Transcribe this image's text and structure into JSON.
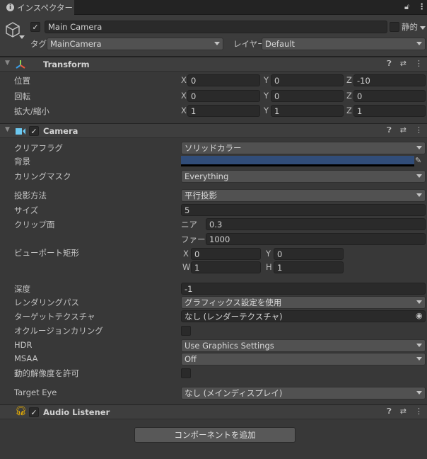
{
  "tab": {
    "title": "インスペクター",
    "icon": "info-icon"
  },
  "tab_icons": [
    "lock-icon",
    "kebab-menu-icon"
  ],
  "object": {
    "active": true,
    "name": "Main Camera",
    "static_label": "静的",
    "static": false,
    "tag_label": "タグ",
    "tag": "MainCamera",
    "layer_label": "レイヤー",
    "layer": "Default",
    "icon": "gameobject-cube-icon"
  },
  "transform": {
    "title": "Transform",
    "icon": "transform-axes-icon",
    "rows": [
      {
        "label": "位置",
        "x": "0",
        "y": "0",
        "z": "-10"
      },
      {
        "label": "回転",
        "x": "0",
        "y": "0",
        "z": "0"
      },
      {
        "label": "拡大/縮小",
        "x": "1",
        "y": "1",
        "z": "1"
      }
    ]
  },
  "axes": {
    "x": "X",
    "y": "Y",
    "z": "Z",
    "w": "W",
    "h": "H"
  },
  "camera": {
    "title": "Camera",
    "enabled": true,
    "icon": "camera-icon",
    "background_color": "#314d79",
    "clear_flags": {
      "label": "クリアフラグ",
      "value": "ソリッドカラー"
    },
    "background": {
      "label": "背景"
    },
    "culling_mask": {
      "label": "カリングマスク",
      "value": "Everything"
    },
    "projection": {
      "label": "投影方法",
      "value": "平行投影"
    },
    "size": {
      "label": "サイズ",
      "value": "5"
    },
    "clipping": {
      "label": "クリップ面",
      "near_label": "ニア",
      "near": "0.3",
      "far_label": "ファー",
      "far": "1000"
    },
    "viewport": {
      "label": "ビューポート矩形",
      "x": "0",
      "y": "0",
      "w": "1",
      "h": "1"
    },
    "depth": {
      "label": "深度",
      "value": "-1"
    },
    "rendering_path": {
      "label": "レンダリングパス",
      "value": "グラフィックス設定を使用"
    },
    "target_texture": {
      "label": "ターゲットテクスチャ",
      "value": "なし (レンダーテクスチャ)"
    },
    "occlusion": {
      "label": "オクルージョンカリング",
      "checked": false
    },
    "hdr": {
      "label": "HDR",
      "value": "Use Graphics Settings"
    },
    "msaa": {
      "label": "MSAA",
      "value": "Off"
    },
    "dynamic_res": {
      "label": "動的解像度を許可",
      "checked": false
    },
    "target_eye": {
      "label": "Target Eye",
      "value": "なし (メインディスプレイ)"
    }
  },
  "audio": {
    "title": "Audio Listener",
    "enabled": true,
    "icon": "headphones-icon"
  },
  "add_component": "コンポーネントを追加"
}
